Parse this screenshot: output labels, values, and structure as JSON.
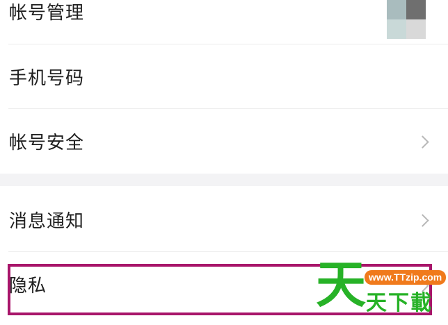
{
  "settings": {
    "rows": [
      {
        "label": "帐号管理",
        "has_avatar": true
      },
      {
        "label": "手机号码"
      },
      {
        "label": "帐号安全",
        "chevron": true
      },
      {
        "label": "消息通知",
        "chevron": true
      },
      {
        "label": "隐私",
        "chevron": true,
        "highlighted": true
      }
    ]
  },
  "watermark": {
    "big_char": "天",
    "url": "www.TTzip.com",
    "text": "天下載"
  },
  "colors": {
    "highlight_border": "#a8156a",
    "watermark_green": "#27b227",
    "watermark_orange": "#f07a1c",
    "section_gap": "#f3f3f5"
  },
  "icons": [
    "chevron-right-icon",
    "avatar-image"
  ]
}
